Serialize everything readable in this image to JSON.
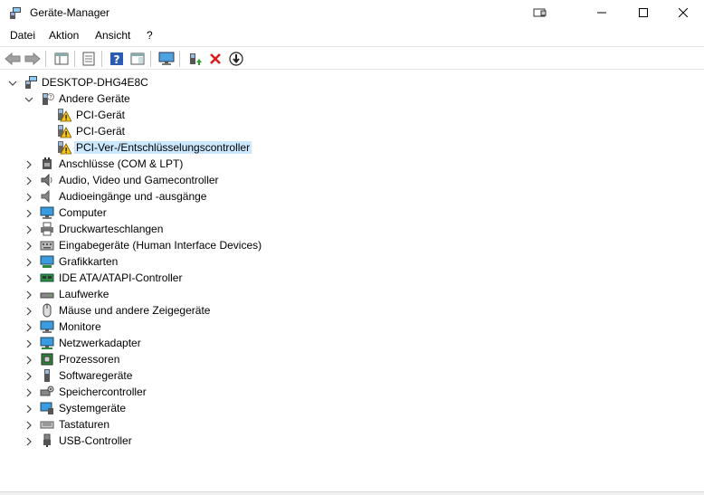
{
  "window": {
    "title": "Geräte-Manager"
  },
  "menu": [
    "Datei",
    "Aktion",
    "Ansicht",
    "?"
  ],
  "tree": {
    "root": "DESKTOP-DHG4E8C",
    "other_devices": {
      "label": "Andere Geräte",
      "children": [
        "PCI-Gerät",
        "PCI-Gerät",
        "PCI-Ver-/Entschlüsselungscontroller"
      ]
    },
    "categories": [
      "Anschlüsse (COM & LPT)",
      "Audio, Video und Gamecontroller",
      "Audioeingänge und -ausgänge",
      "Computer",
      "Druckwarteschlangen",
      "Eingabegeräte (Human Interface Devices)",
      "Grafikkarten",
      "IDE ATA/ATAPI-Controller",
      "Laufwerke",
      "Mäuse und andere Zeigegeräte",
      "Monitore",
      "Netzwerkadapter",
      "Prozessoren",
      "Softwaregeräte",
      "Speichercontroller",
      "Systemgeräte",
      "Tastaturen",
      "USB-Controller"
    ]
  }
}
